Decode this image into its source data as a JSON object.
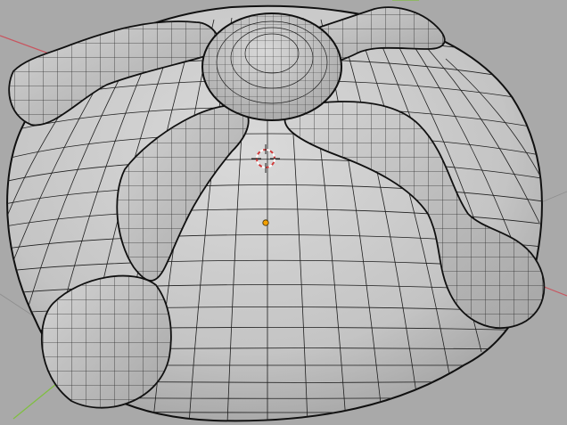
{
  "viewport": {
    "background_color": "#a9a9a9",
    "mesh_fill_color": "#c9c9c9",
    "mesh_wire_color": "#1e1e1e",
    "mesh_outline_color": "#101010",
    "axis_x_color": "#c8555f",
    "axis_y_color": "#7fbf3f",
    "origin_color": "#f4a000",
    "cursor_colors": [
      "#d03a3a",
      "#ffffff"
    ]
  },
  "objects": {
    "mesh": {
      "icon": "mesh-object"
    },
    "origin": {
      "icon": "object-origin-dot"
    },
    "cursor": {
      "icon": "3d-cursor-crosshair"
    }
  }
}
